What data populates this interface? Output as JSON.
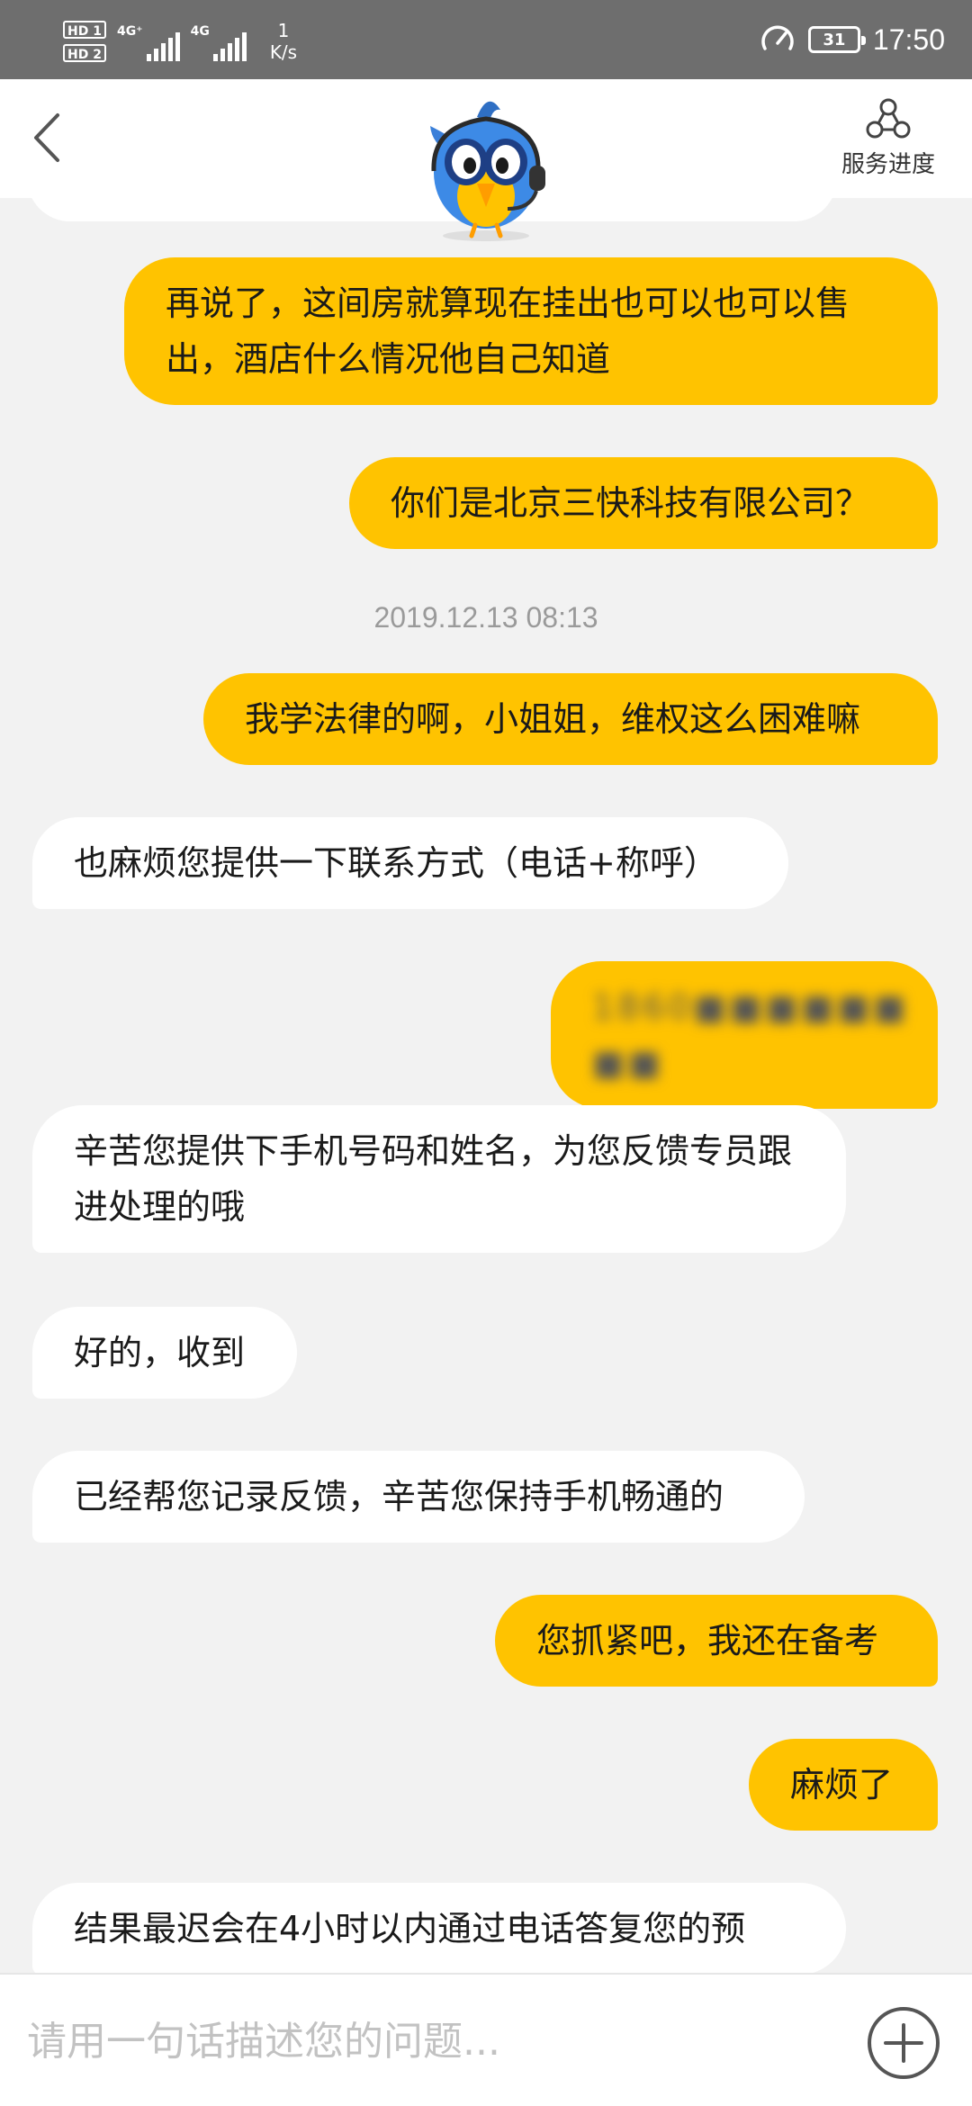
{
  "status_bar": {
    "hd1": "HD 1",
    "hd2": "HD 2",
    "sim1_label": "4G⁺",
    "sim2_label": "4G",
    "net_speed_value": "1",
    "net_speed_unit": "K/s",
    "battery_level": "31",
    "time": "17:50"
  },
  "header": {
    "progress_label": "服务进度"
  },
  "messages": [
    {
      "from": "me",
      "text": "再说了，这间房就算现在挂出也可以也可以售出，酒店什么情况他自己知道"
    },
    {
      "from": "me",
      "text": "你们是北京三快科技有限公司？"
    },
    {
      "type": "timestamp",
      "text": "2019.12.13 08:13"
    },
    {
      "from": "me",
      "text": "我学法律的啊，小姐姐，维权这么困难嘛"
    },
    {
      "from": "them",
      "text": "也麻烦您提供一下联系方式（电话+称呼）"
    },
    {
      "from": "me",
      "text": "1860■■■■■■ ■■",
      "redacted": true
    },
    {
      "from": "them",
      "text": "辛苦您提供下手机号码和姓名，为您反馈专员跟进处理的哦"
    },
    {
      "from": "them",
      "text": "好的，收到"
    },
    {
      "from": "them",
      "text": "已经帮您记录反馈，辛苦您保持手机畅通的"
    },
    {
      "from": "me",
      "text": "您抓紧吧，我还在备考"
    },
    {
      "from": "me",
      "text": "麻烦了"
    },
    {
      "from": "them",
      "text": "结果最迟会在4小时以内通过电话答复您的预"
    }
  ],
  "input": {
    "placeholder": "请用一句话描述您的问题..."
  },
  "colors": {
    "my_bubble": "#ffc300",
    "their_bubble": "#ffffff",
    "chat_background": "#f2f2f2",
    "status_bar": "#6e6e6e"
  },
  "icons": {
    "back": "chevron-left-icon",
    "service_progress": "three-circle-network-icon",
    "add": "plus-circle-icon",
    "mascot": "bird-mascot-with-headset"
  }
}
